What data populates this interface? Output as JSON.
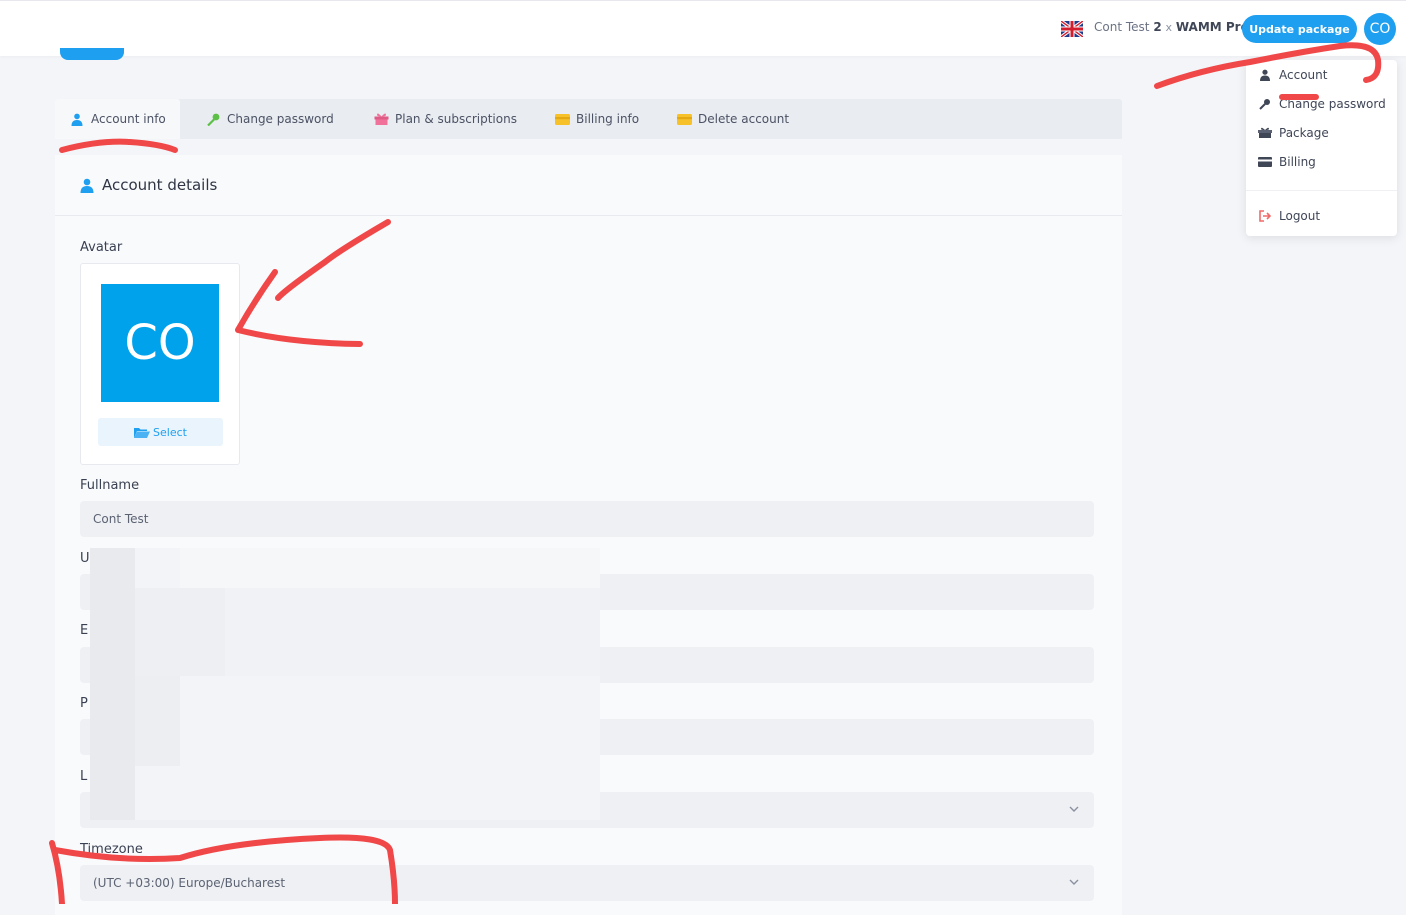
{
  "header": {
    "user_name": "Cont Test",
    "plan_count": "2",
    "plan_multiplier": "x",
    "plan_name": "WAMM Pro",
    "update_button": "Update package",
    "avatar_initials": "CO"
  },
  "dropdown": {
    "items": [
      {
        "label": "Account",
        "icon": "user-icon"
      },
      {
        "label": "Change password",
        "icon": "key-icon"
      },
      {
        "label": "Package",
        "icon": "gift-icon"
      },
      {
        "label": "Billing",
        "icon": "card-icon"
      },
      {
        "label": "Logout",
        "icon": "logout-icon"
      }
    ]
  },
  "tabs": [
    {
      "label": "Account info",
      "icon": "user-icon",
      "active": true
    },
    {
      "label": "Change password",
      "icon": "key-icon"
    },
    {
      "label": "Plan & subscriptions",
      "icon": "gift-icon"
    },
    {
      "label": "Billing info",
      "icon": "card-icon"
    },
    {
      "label": "Delete account",
      "icon": "card-icon"
    }
  ],
  "card": {
    "title": "Account details",
    "avatar_label": "Avatar",
    "avatar_initials": "CO",
    "select_button": "Select",
    "fullname_label": "Fullname",
    "fullname_value": "Cont Test",
    "hidden_labels": [
      "U",
      "E",
      "P",
      "L"
    ],
    "timezone_label": "Timezone",
    "timezone_value": "(UTC +03:00) Europe/Bucharest"
  },
  "colors": {
    "accent": "#1f9ff0",
    "avatar_bg": "#00a2ec",
    "annotation": "#f04848"
  }
}
